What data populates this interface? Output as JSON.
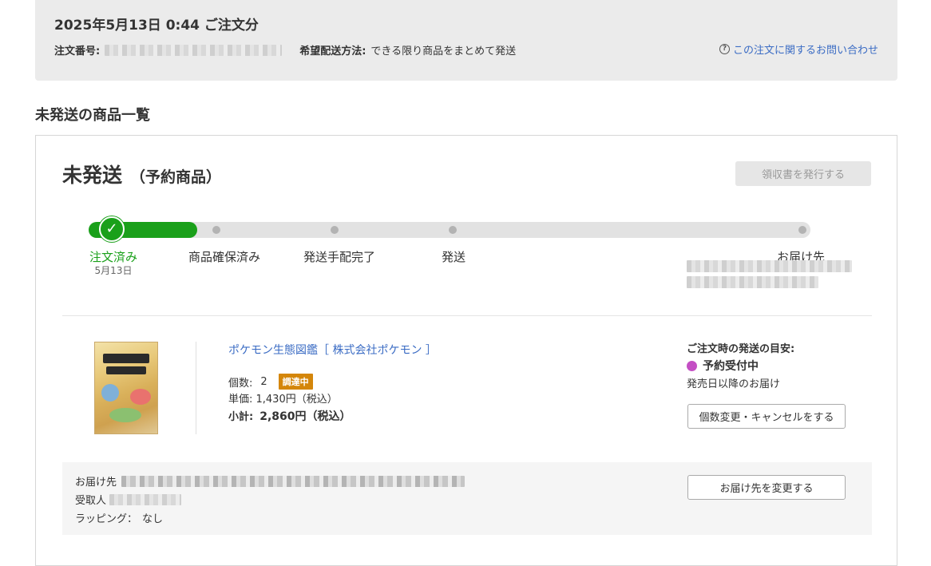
{
  "order": {
    "title": "2025年5月13日 0:44 ご注文分",
    "number_label": "注文番号:",
    "shipping_method_label": "希望配送方法:",
    "shipping_method_value": "できる限り商品をまとめて発送",
    "inquiry_link": "この注文に関するお問い合わせ",
    "inquiry_icon": "question-circle-icon"
  },
  "section": {
    "title": "未発送の商品一覧"
  },
  "shipment": {
    "status": "未発送",
    "status_sub": "（予約商品）",
    "receipt_button": "領収書を発行する",
    "progress_fraction": 0.15,
    "steps": [
      {
        "label": "注文済み",
        "date": "5月13日",
        "done": true
      },
      {
        "label": "商品確保済み",
        "done": false
      },
      {
        "label": "発送手配完了",
        "done": false
      },
      {
        "label": "発送",
        "done": false
      },
      {
        "label": "お届け先",
        "done": false
      }
    ],
    "check_icon": "checkmark-icon",
    "colors": {
      "progress": "#1aa01a",
      "reservation": "#c44fc4",
      "badge": "#d4860a",
      "link": "#3b6cc4"
    }
  },
  "item": {
    "name": "ポケモン生態図鑑［ 株式会社ポケモン ］",
    "qty_label": "個数:",
    "qty_value": "2",
    "badge": "調達中",
    "unit_price": "単価:  1,430円（税込）",
    "subtotal_label": "小計:",
    "subtotal_value": "2,860円（税込）"
  },
  "shipping_guide": {
    "label": "ご注文時の発送の目安:",
    "status": "予約受付中",
    "note": "発売日以降のお届け",
    "change_button": "個数変更・キャンセルをする"
  },
  "delivery": {
    "address_label": "お届け先",
    "recipient_label": "受取人",
    "wrapping_label": "ラッピング：",
    "wrapping_value": "なし",
    "change_button": "お届け先を変更する"
  }
}
